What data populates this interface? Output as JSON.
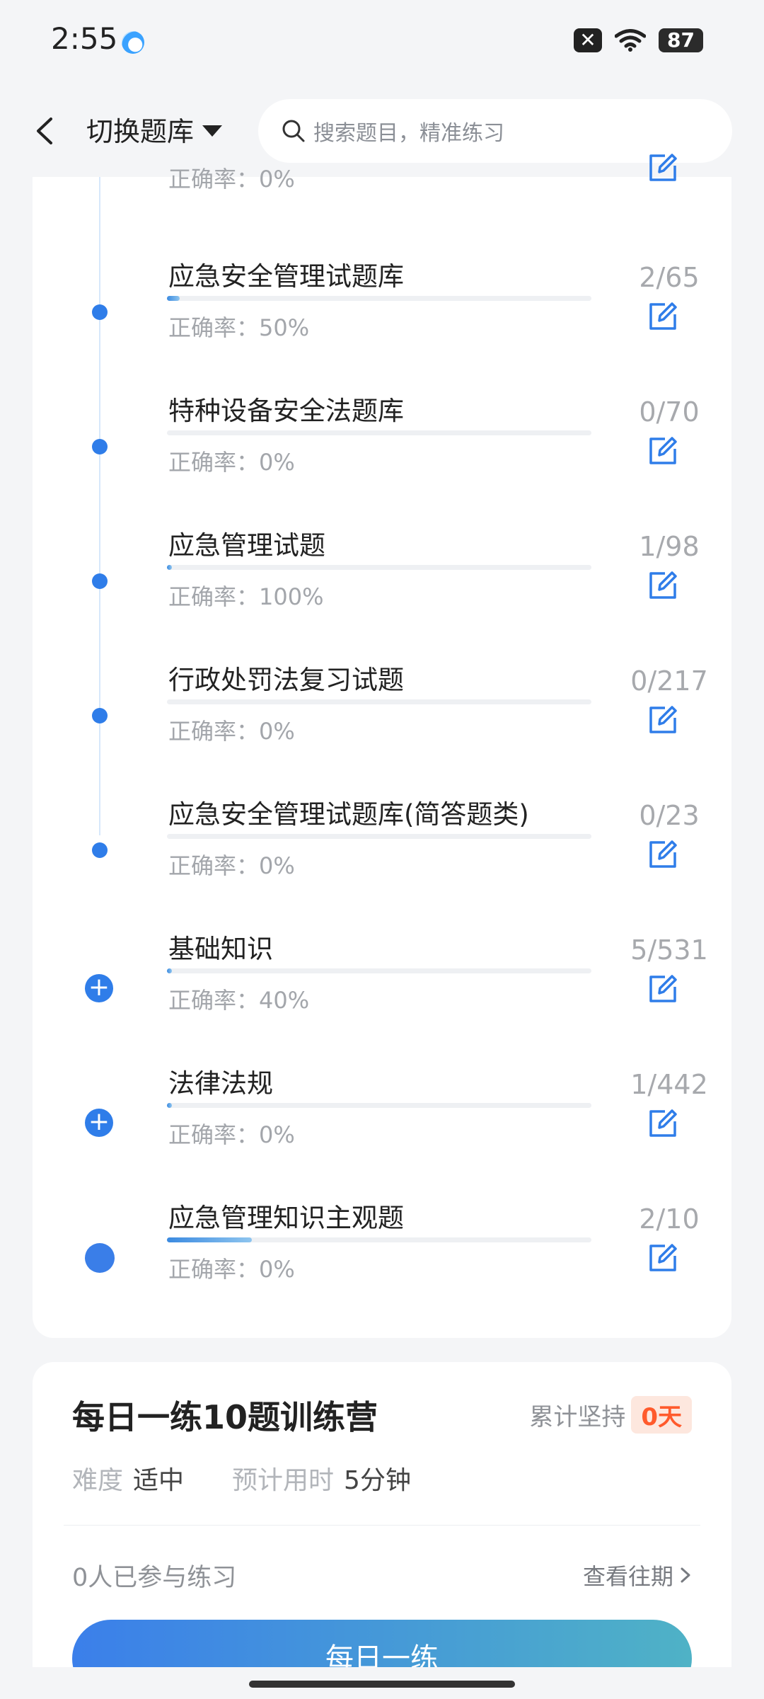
{
  "status": {
    "time": "2:55",
    "battery": "87"
  },
  "header": {
    "title": "切换题库",
    "search_placeholder": "搜索题目，精准练习"
  },
  "accuracy_label": "正确率：",
  "items": [
    {
      "title": "",
      "count": "",
      "accuracy": "0%",
      "progress": 0
    },
    {
      "title": "应急安全管理试题库",
      "count": "2/65",
      "accuracy": "50%",
      "progress": 0.03
    },
    {
      "title": "特种设备安全法题库",
      "count": "0/70",
      "accuracy": "0%",
      "progress": 0
    },
    {
      "title": "应急管理试题",
      "count": "1/98",
      "accuracy": "100%",
      "progress": 0.01
    },
    {
      "title": "行政处罚法复习试题",
      "count": "0/217",
      "accuracy": "0%",
      "progress": 0
    },
    {
      "title": "应急安全管理试题库(简答题类)",
      "count": "0/23",
      "accuracy": "0%",
      "progress": 0
    },
    {
      "title": "基础知识",
      "count": "5/531",
      "accuracy": "40%",
      "progress": 0.01
    },
    {
      "title": "法律法规",
      "count": "1/442",
      "accuracy": "0%",
      "progress": 0.002
    },
    {
      "title": "应急管理知识主观题",
      "count": "2/10",
      "accuracy": "0%",
      "progress": 0.2
    }
  ],
  "daily": {
    "title": "每日一练10题训练营",
    "streak_label": "累计坚持",
    "streak_value": "0天",
    "difficulty_key": "难度",
    "difficulty_value": "适中",
    "time_key": "预计用时",
    "time_value": "5分钟",
    "participants": "0人已参与练习",
    "history_link": "查看往期",
    "button": "每日一练"
  }
}
